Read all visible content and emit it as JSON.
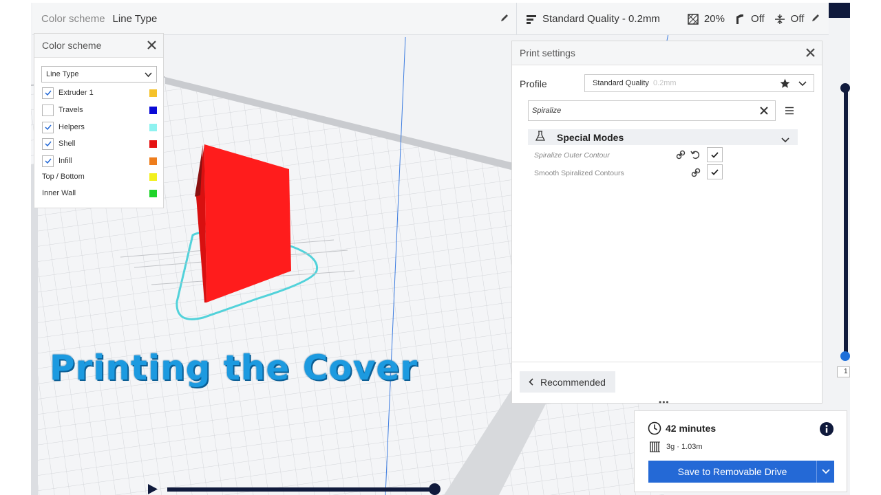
{
  "topbar": {
    "color_scheme_label": "Color scheme",
    "color_scheme_value": "Line Type",
    "quality": "Standard Quality - 0.2mm",
    "infill": "20%",
    "support": "Off",
    "adhesion": "Off"
  },
  "color_scheme_panel": {
    "title": "Color scheme",
    "select_value": "Line Type",
    "items": [
      {
        "label": "Extruder 1",
        "checked": true,
        "color": "#f5c22a"
      },
      {
        "label": "Travels",
        "checked": false,
        "color": "#0a0ad6"
      },
      {
        "label": "Helpers",
        "checked": true,
        "color": "#8ef2f0"
      },
      {
        "label": "Shell",
        "checked": true,
        "color": "#e61212"
      },
      {
        "label": "Infill",
        "checked": true,
        "color": "#ee7d1c"
      },
      {
        "label": "Top / Bottom",
        "color": "#f2f01e"
      },
      {
        "label": "Inner Wall",
        "color": "#1fd42a"
      }
    ]
  },
  "print_settings": {
    "title": "Print settings",
    "profile_label": "Profile",
    "profile_name": "Standard Quality",
    "profile_sub": "0.2mm",
    "search_value": "Spiralize",
    "category": "Special Modes",
    "settings": [
      {
        "label": "Spiralize Outer Contour",
        "checked": true
      },
      {
        "label": "Smooth Spiralized Contours",
        "checked": true
      }
    ],
    "recommended_label": "Recommended",
    "handle": "•••"
  },
  "layer_slider": {
    "value": "1"
  },
  "estimate": {
    "time": "42 minutes",
    "material": "3g · 1.03m",
    "save_label": "Save to Removable Drive"
  },
  "overlay": {
    "title": "Printing the Cover"
  },
  "colors": {
    "accent": "#2469d6",
    "dark": "#101a3c",
    "title_blue": "#1c9ae0"
  }
}
